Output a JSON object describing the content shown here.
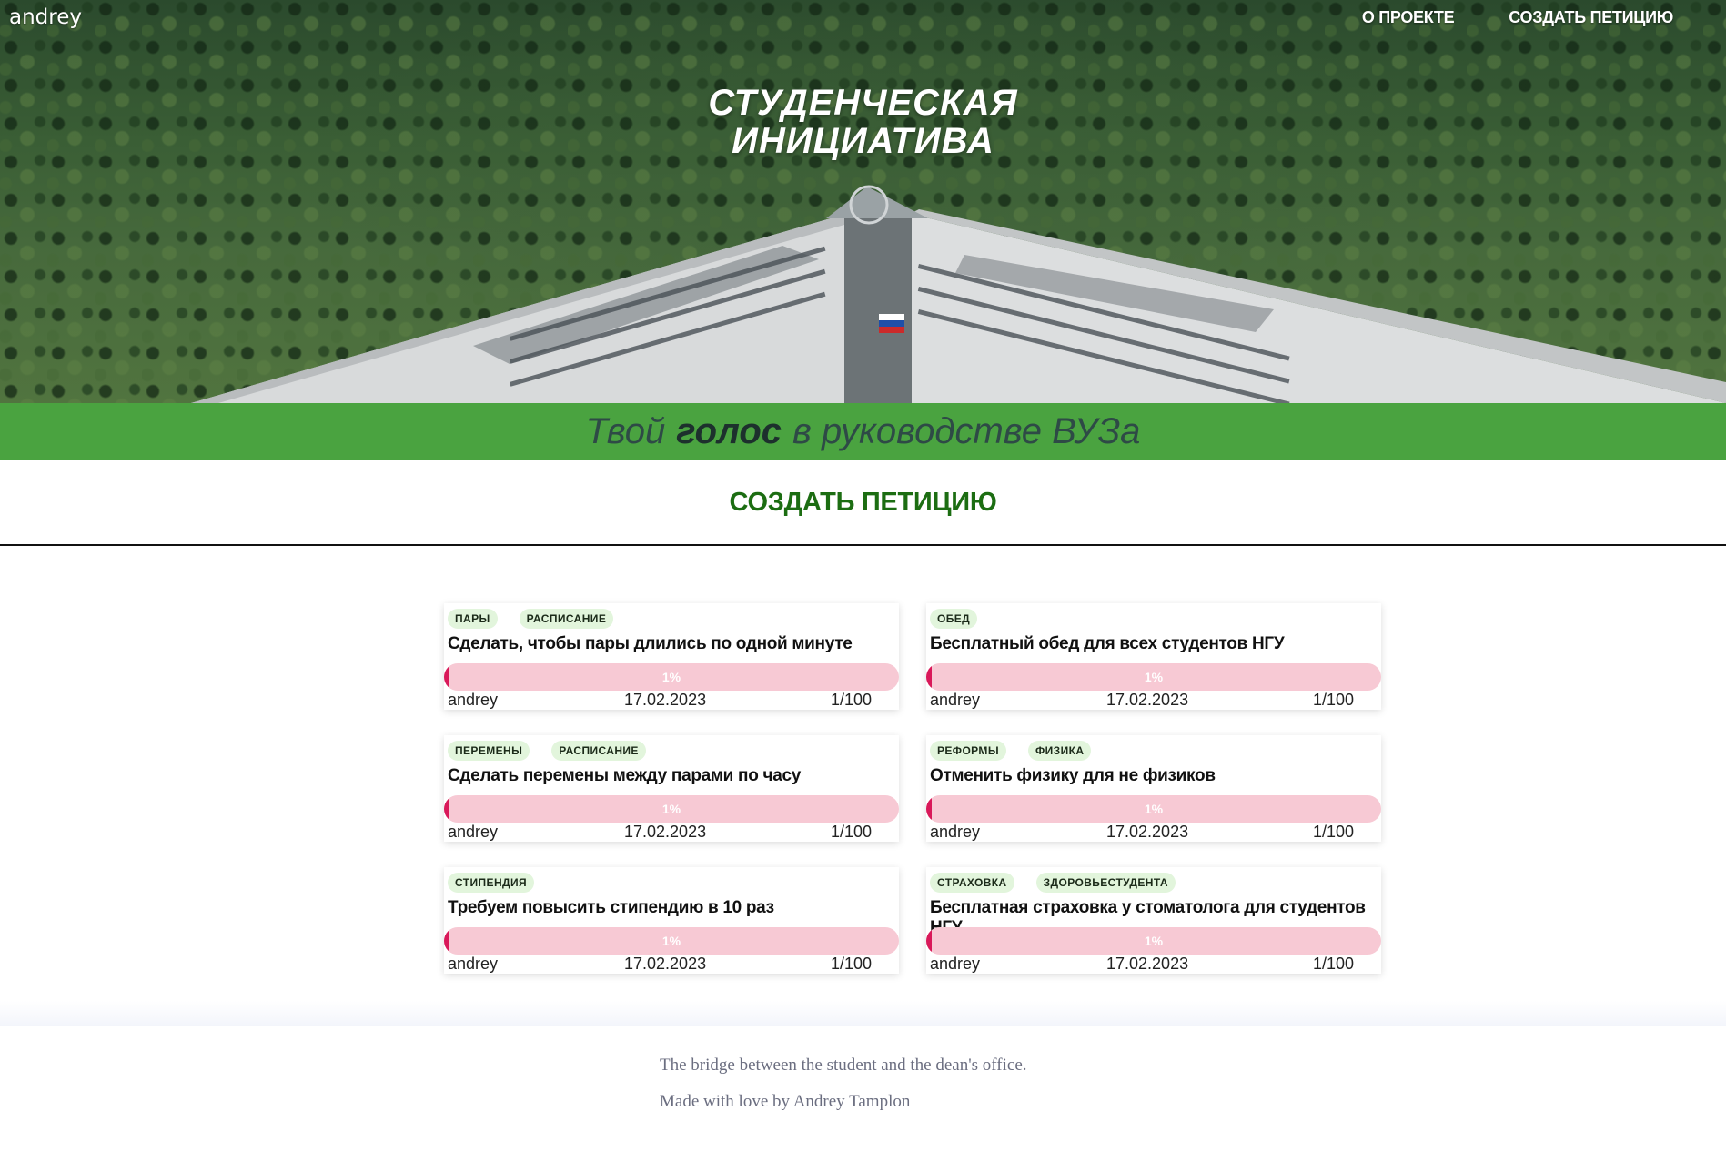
{
  "header": {
    "user": "andrey",
    "nav": [
      {
        "label": "О ПРОЕКТЕ"
      },
      {
        "label": "СОЗДАТЬ ПЕТИЦИЮ"
      }
    ],
    "title_line1": "СТУДЕНЧЕСКАЯ",
    "title_line2": "ИНИЦИАТИВА"
  },
  "slogan": {
    "before": "Твой",
    "bold": "голос",
    "after": "в руководстве ВУЗа"
  },
  "cta": {
    "label": "СОЗДАТЬ ПЕТИЦИЮ"
  },
  "colors": {
    "accent_green": "#4aa340",
    "cta_green": "#1c6d12",
    "progress_bg": "#f7c9d4",
    "progress_fill": "#d9195a",
    "tag_bg": "#e2f5dc"
  },
  "petitions": [
    {
      "tags": [
        "ПАРЫ",
        "РАСПИСАНИЕ"
      ],
      "title": "Сделать, чтобы пары длились по одной минуте",
      "progress_pct": 1,
      "progress_label": "1%",
      "author": "andrey",
      "date": "17.02.2023",
      "count": "1/100"
    },
    {
      "tags": [
        "ОБЕД"
      ],
      "title": "Бесплатный обед для всех студентов НГУ",
      "progress_pct": 1,
      "progress_label": "1%",
      "author": "andrey",
      "date": "17.02.2023",
      "count": "1/100"
    },
    {
      "tags": [
        "ПЕРЕМЕНЫ",
        "РАСПИСАНИЕ"
      ],
      "title": "Сделать перемены между парами по часу",
      "progress_pct": 1,
      "progress_label": "1%",
      "author": "andrey",
      "date": "17.02.2023",
      "count": "1/100"
    },
    {
      "tags": [
        "РЕФОРМЫ",
        "ФИЗИКА"
      ],
      "title": "Отменить физику для не физиков",
      "progress_pct": 1,
      "progress_label": "1%",
      "author": "andrey",
      "date": "17.02.2023",
      "count": "1/100"
    },
    {
      "tags": [
        "СТИПЕНДИЯ"
      ],
      "title": "Требуем повысить стипендию в 10 раз",
      "progress_pct": 1,
      "progress_label": "1%",
      "author": "andrey",
      "date": "17.02.2023",
      "count": "1/100"
    },
    {
      "tags": [
        "СТРАХОВКА",
        "ЗДОРОВЬЕСТУДЕНТА"
      ],
      "title": "Бесплатная страховка у стоматолога для студентов НГУ",
      "progress_pct": 1,
      "progress_label": "1%",
      "author": "andrey",
      "date": "17.02.2023",
      "count": "1/100"
    }
  ],
  "footer": {
    "line1": "The bridge between the student and the dean's office.",
    "line2": "Made with love by  Andrey Tamplon"
  }
}
